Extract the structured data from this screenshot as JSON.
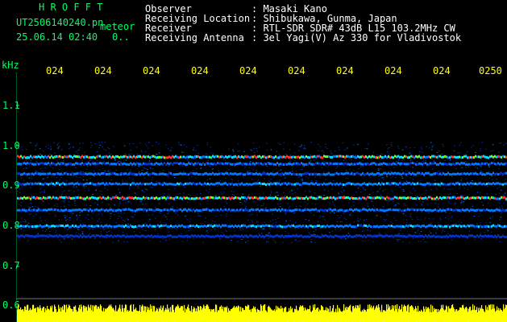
{
  "header": {
    "app_title": "H R O F F T",
    "file_name": "UT2506140240.pn",
    "file_suffix": "meteor",
    "date_time": "25.06.14 02:40",
    "small_mark": "0..",
    "fields": [
      {
        "label": "Observer",
        "value": ": Masaki Kano"
      },
      {
        "label": "Receiving Location",
        "value": ": Shibukawa, Gunma, Japan"
      },
      {
        "label": "Receiver",
        "value": ": RTL-SDR SDR# 43dB L15 103.2MHz CW"
      },
      {
        "label": "Receiving Antenna",
        "value": ": 3el Yagi(V) Az 330 for Vladivostok"
      }
    ]
  },
  "colors": {
    "background": "#000000",
    "header_text": "#ffffff",
    "axis_text": "#00ff66",
    "time_labels": "#ffff00",
    "power_bars": "#ffff00"
  },
  "chart_data": {
    "type": "heatmap",
    "title": "",
    "xlabel": "",
    "ylabel": "kHz",
    "x_tick_labels": [
      "024",
      "024",
      "024",
      "024",
      "024",
      "024",
      "024",
      "024",
      "024",
      "0250"
    ],
    "y_ticks": [
      {
        "label": "1.1",
        "value": 1.1
      },
      {
        "label": "1.0",
        "value": 1.0
      },
      {
        "label": "0.9",
        "value": 0.9
      },
      {
        "label": "0.8",
        "value": 0.8
      },
      {
        "label": "0.7",
        "value": 0.7
      },
      {
        "label": "0.6",
        "value": 0.6
      }
    ],
    "ylim": [
      0.58,
      1.22
    ],
    "grid": false,
    "signal_bands_khz": [
      {
        "center": 0.972,
        "strength": 0.9
      },
      {
        "center": 0.955,
        "strength": 0.45
      },
      {
        "center": 0.93,
        "strength": 0.5
      },
      {
        "center": 0.905,
        "strength": 0.55
      },
      {
        "center": 0.87,
        "strength": 0.95
      },
      {
        "center": 0.84,
        "strength": 0.5
      },
      {
        "center": 0.8,
        "strength": 0.6
      },
      {
        "center": 0.775,
        "strength": 0.3
      }
    ],
    "signal_extent_khz": [
      0.76,
      1.01
    ],
    "power_strip_kHz_level": 0.6
  }
}
